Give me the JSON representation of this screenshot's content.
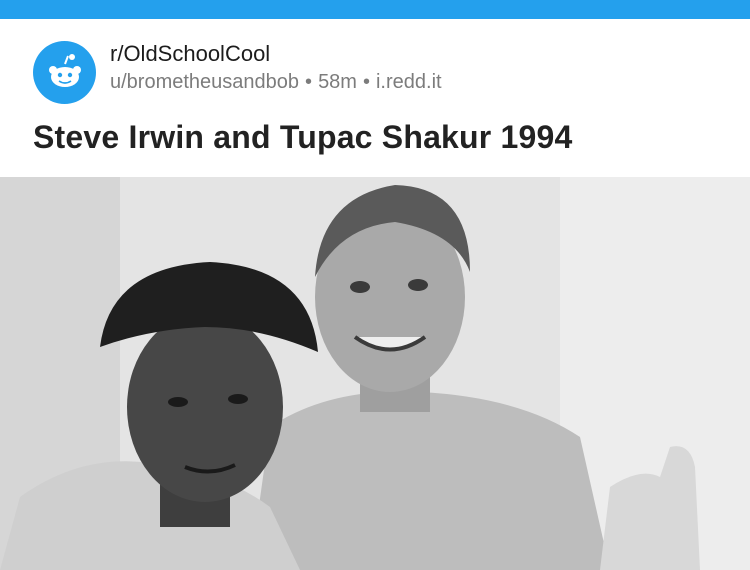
{
  "post": {
    "subreddit": "r/OldSchoolCool",
    "author": "u/brometheusandbob",
    "separator": "•",
    "age": "58m",
    "domain": "i.redd.it",
    "title": "Steve Irwin and Tupac Shakur 1994"
  },
  "icons": {
    "subreddit_icon": "reddit-alien-icon"
  },
  "colors": {
    "topbar": "#24a0ed",
    "icon_bg": "#24a0ed",
    "title_text": "#222222",
    "meta_text": "#7c7c7c"
  }
}
